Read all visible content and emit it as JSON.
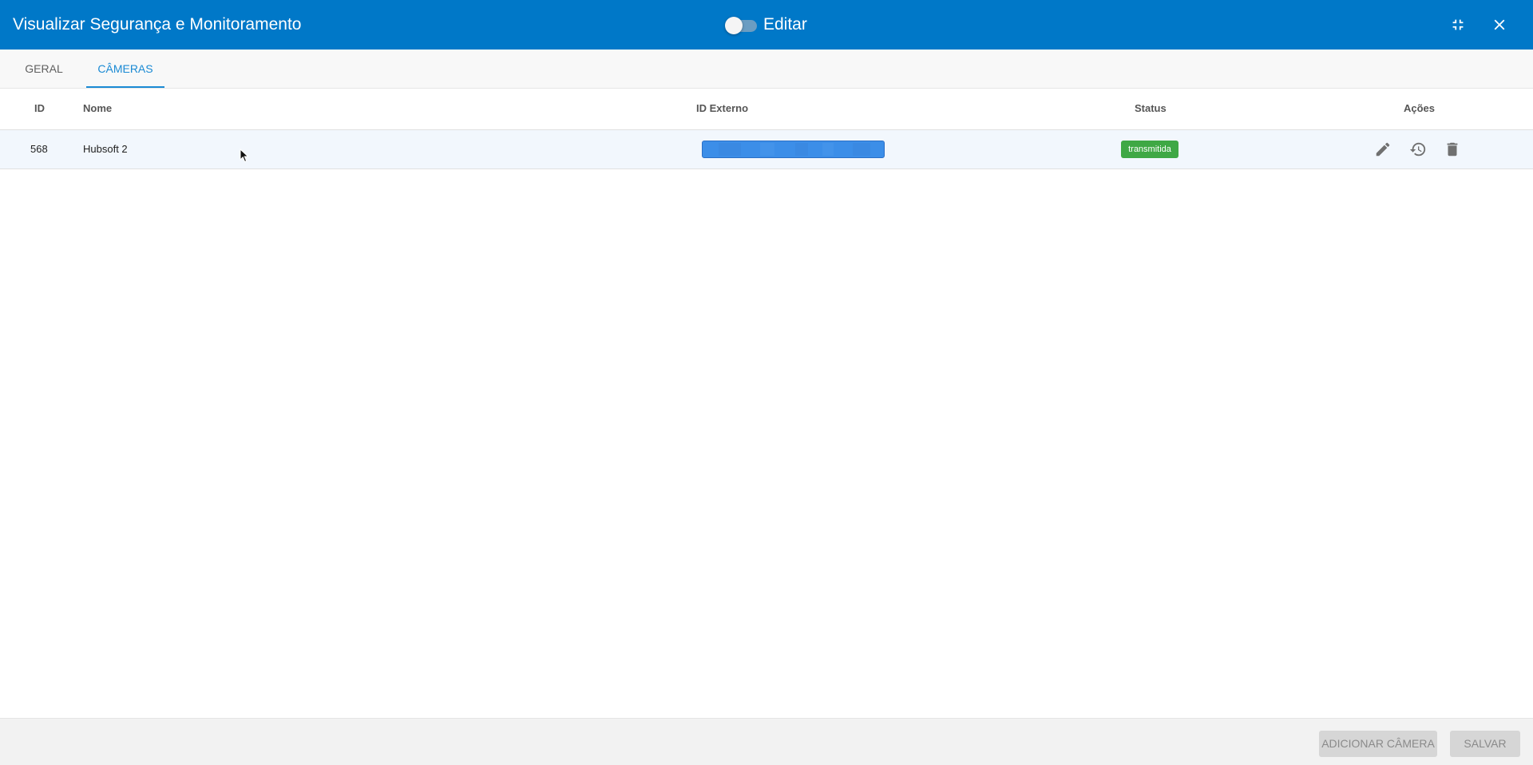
{
  "header": {
    "title": "Visualizar Segurança e Monitoramento",
    "edit_toggle": {
      "label": "Editar",
      "checked": false
    },
    "icons": {
      "minimize": "fullscreen-exit-icon",
      "close": "close-icon"
    }
  },
  "tabs": [
    {
      "label": "GERAL",
      "active": false
    },
    {
      "label": "CÂMERAS",
      "active": true
    }
  ],
  "table": {
    "columns": [
      "ID",
      "Nome",
      "ID Externo",
      "Status",
      "Ações"
    ],
    "rows": [
      {
        "id": "568",
        "nome": "Hubsoft 2",
        "id_externo": "",
        "status": "transmitida",
        "actions": [
          "pencil-icon",
          "history-icon",
          "trash-icon"
        ]
      }
    ]
  },
  "footer": {
    "add_camera_label": "ADICIONAR CÂMERA",
    "save_label": "SALVAR"
  },
  "colors": {
    "header_bg": "#0078c8",
    "active_tab": "#1a8ad4",
    "status_badge": "#3fa845",
    "redacted_bar": "#3c8ee8"
  }
}
